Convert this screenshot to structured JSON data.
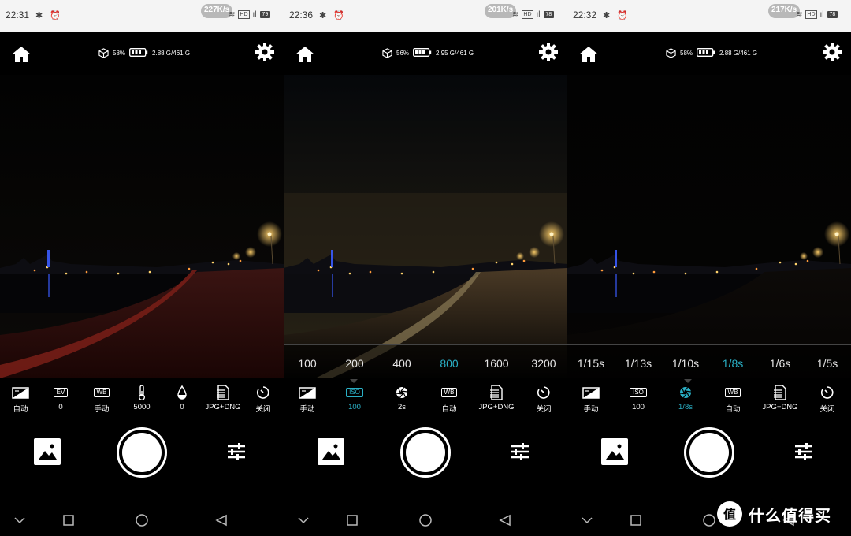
{
  "panels": [
    {
      "status": {
        "time": "22:31",
        "icons": "✱ ⏰",
        "speed": "227K/s",
        "hd": "HD",
        "signal": "ıl",
        "battery": "79"
      },
      "camera": {
        "battery_pct": "58%",
        "storage": "2.88 G/461 G"
      },
      "picker": {
        "values": []
      },
      "params": [
        {
          "icon": "exposure-icon",
          "label": "自动",
          "tag": ""
        },
        {
          "icon": "ev-icon",
          "label": "0",
          "tag": "EV"
        },
        {
          "icon": "wb-icon",
          "label": "手动",
          "tag": "WB"
        },
        {
          "icon": "thermometer-icon",
          "label": "5000",
          "tag": ""
        },
        {
          "icon": "tint-icon",
          "label": "0",
          "tag": ""
        },
        {
          "icon": "file-format-icon",
          "label": "JPG+DNG",
          "tag": ""
        },
        {
          "icon": "timer-icon",
          "label": "关闭",
          "tag": ""
        }
      ]
    },
    {
      "status": {
        "time": "22:36",
        "icons": "✱ ⏰",
        "speed": "201K/s",
        "hd": "HD",
        "signal": "ıl",
        "battery": "78"
      },
      "camera": {
        "battery_pct": "56%",
        "storage": "2.95 G/461 G"
      },
      "picker": {
        "values": [
          "100",
          "200",
          "400",
          "800",
          "1600",
          "3200"
        ],
        "selected": 3
      },
      "params": [
        {
          "icon": "exposure-icon",
          "label": "手动",
          "tag": ""
        },
        {
          "icon": "iso-icon",
          "label": "100",
          "tag": "ISO",
          "active": true
        },
        {
          "icon": "aperture-icon",
          "label": "2s",
          "tag": ""
        },
        {
          "icon": "wb-icon",
          "label": "自动",
          "tag": "WB"
        },
        {
          "icon": "file-format-icon",
          "label": "JPG+DNG",
          "tag": ""
        },
        {
          "icon": "timer-icon",
          "label": "关闭",
          "tag": ""
        }
      ]
    },
    {
      "status": {
        "time": "22:32",
        "icons": "✱ ⏰",
        "speed": "217K/s",
        "hd": "HD",
        "signal": "ıl",
        "battery": "78"
      },
      "camera": {
        "battery_pct": "58%",
        "storage": "2.88 G/461 G"
      },
      "picker": {
        "values": [
          "1/15s",
          "1/13s",
          "1/10s",
          "1/8s",
          "1/6s",
          "1/5s"
        ],
        "selected": 3
      },
      "params": [
        {
          "icon": "exposure-icon",
          "label": "手动",
          "tag": ""
        },
        {
          "icon": "iso-icon",
          "label": "100",
          "tag": "ISO"
        },
        {
          "icon": "aperture-icon",
          "label": "1/8s",
          "tag": "",
          "active": true
        },
        {
          "icon": "wb-icon",
          "label": "自动",
          "tag": "WB"
        },
        {
          "icon": "file-format-icon",
          "label": "JPG+DNG",
          "tag": ""
        },
        {
          "icon": "timer-icon",
          "label": "关闭",
          "tag": ""
        }
      ]
    }
  ],
  "colors": {
    "accent": "#2ab0c6",
    "statusbar": "#f4f4f4"
  },
  "watermark": {
    "text": "什么值得买"
  }
}
